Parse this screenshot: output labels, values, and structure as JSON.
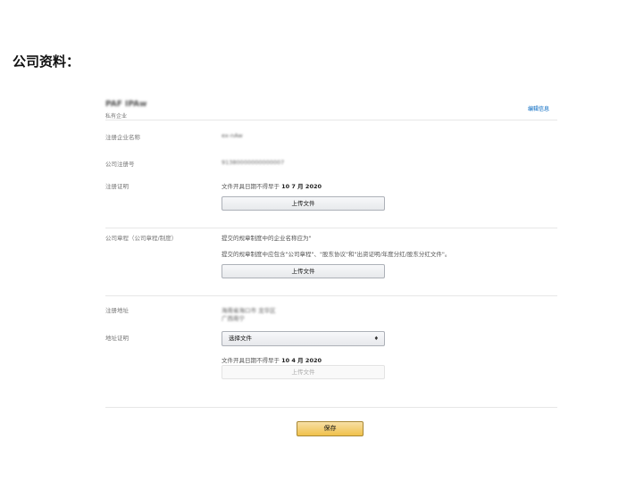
{
  "page": {
    "heading": "公司资料："
  },
  "header": {
    "company_name": "PAF IPAw",
    "company_type": "私有企业",
    "edit_label": "编辑信息"
  },
  "fields": {
    "registered_name": {
      "label": "注册企业名称",
      "value": "ex-nAw"
    },
    "registration_number": {
      "label": "公司注册号",
      "value": "91380000000000007"
    },
    "registration_proof": {
      "label": "注册证明",
      "note_prefix": "文件开具日期不得早于",
      "note_date": "10 7 月 2020",
      "button": "上传文件"
    },
    "articles": {
      "label": "公司章程（公司章程/制度）",
      "line1": "提交的规章制度中的企业名称应为\"",
      "line2": "提交的规章制度中应包含\"公司章程\"、\"股东协议\"和\"出资证明/年度分红/股东分红文件\"。",
      "button": "上传文件"
    },
    "registered_address": {
      "label": "注册地址",
      "line1": "海南省海口市 龙华区",
      "line2": "广西南宁"
    },
    "address_proof": {
      "label": "地址证明",
      "select_value": "选择文件",
      "select_arrow": "♦",
      "note_prefix": "文件开具日期不得早于",
      "note_date": "10 4 月 2020",
      "button": "上传文件"
    }
  },
  "footer": {
    "save_label": "保存"
  }
}
